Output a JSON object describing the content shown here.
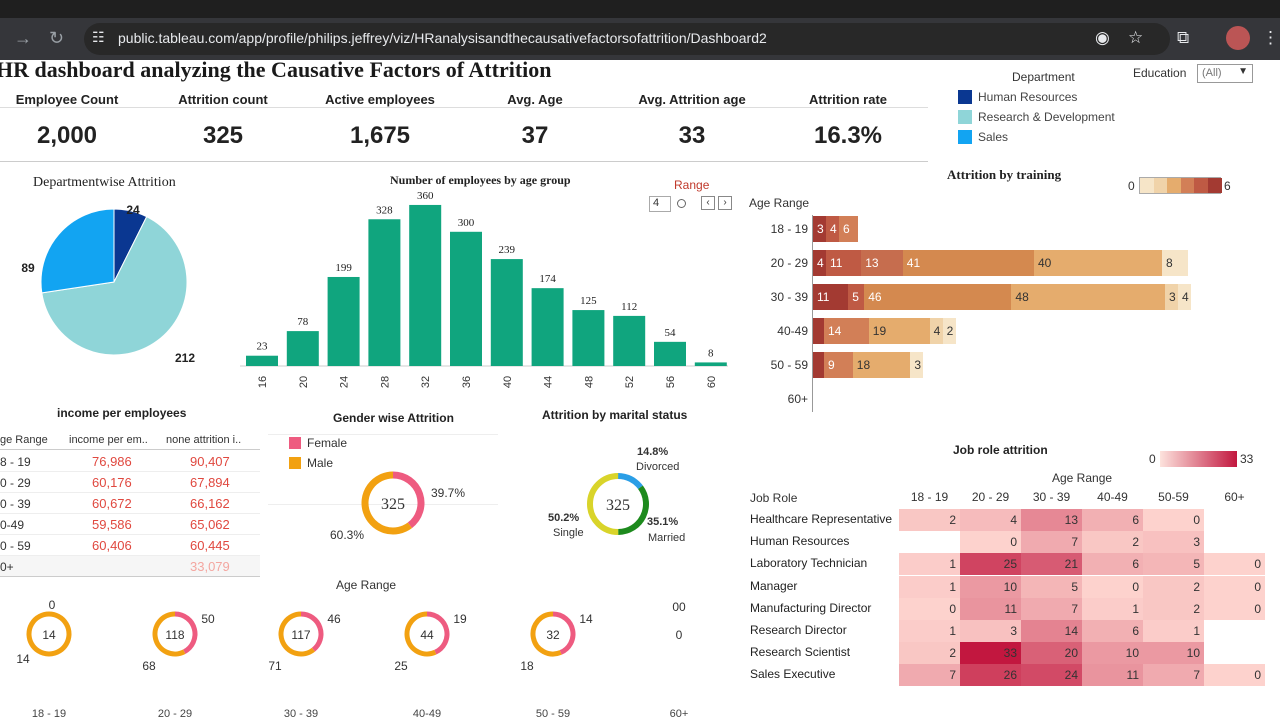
{
  "browser": {
    "url": "public.tableau.com/app/profile/philips.jeffrey/viz/HRanalysisandthecausativefactorsofattrition/Dashboard2"
  },
  "dashboard": {
    "title": "HR dashboard analyzing the Causative Factors of Attrition",
    "kpis": [
      {
        "label": "Employee Count",
        "value": "2,000"
      },
      {
        "label": "Attrition count",
        "value": "325"
      },
      {
        "label": "Active employees",
        "value": "1,675"
      },
      {
        "label": "Avg. Age",
        "value": "37"
      },
      {
        "label": "Avg. Attrition age",
        "value": "33"
      },
      {
        "label": "Attrition rate",
        "value": "16.3%"
      }
    ],
    "department_legend": {
      "title": "Department",
      "items": [
        {
          "label": "Human Resources",
          "color": "#0a3791"
        },
        {
          "label": "Research & Development",
          "color": "#8fd5d8"
        },
        {
          "label": "Sales",
          "color": "#12a4f2"
        }
      ]
    },
    "education_filter": {
      "label": "Education",
      "value": "(All)"
    },
    "range_control": {
      "label": "Range",
      "value": "4"
    }
  },
  "chart_data": [
    {
      "type": "pie",
      "title": "Departmentwise Attrition",
      "categories": [
        "Human Resources",
        "Research & Development",
        "Sales"
      ],
      "values": [
        24,
        212,
        89
      ],
      "colors": [
        "#0a3791",
        "#8fd5d8",
        "#12a4f2"
      ]
    },
    {
      "type": "bar",
      "title": "Number of employees by age group",
      "categories": [
        "16",
        "20",
        "24",
        "28",
        "32",
        "36",
        "40",
        "44",
        "48",
        "52",
        "56",
        "60"
      ],
      "values": [
        23,
        78,
        199,
        328,
        360,
        300,
        239,
        174,
        125,
        112,
        54,
        8
      ],
      "color": "#10a57e"
    },
    {
      "type": "bar",
      "title": "Attrition by training",
      "ylabel": "Age Range",
      "legend_min": "0",
      "legend_max": "6",
      "stacked": true,
      "categories": [
        "18 - 19",
        "20 - 29",
        "30 - 39",
        "40-49",
        "50 - 59",
        "60+"
      ],
      "rows": [
        [
          3,
          4,
          6
        ],
        [
          4,
          11,
          13,
          41,
          40,
          8
        ],
        [
          11,
          5,
          46,
          48,
          3,
          4
        ],
        [
          null,
          14,
          19,
          4,
          2
        ],
        [
          null,
          9,
          18,
          3
        ],
        []
      ],
      "row_labels": [
        [
          "3",
          "4",
          "6"
        ],
        [
          "4",
          "11",
          "13",
          "41",
          "40",
          "8"
        ],
        [
          "11",
          "5",
          "46",
          "48",
          "3",
          "4"
        ],
        [
          "",
          "14",
          "19",
          "4",
          "2"
        ],
        [
          "",
          "9",
          "18",
          "3"
        ],
        []
      ],
      "segment_colors": [
        "#a33a32",
        "#bf5a44",
        "#d27f57",
        "#e5ac6d",
        "#f0d3a9",
        "#f6e5c8"
      ]
    },
    {
      "type": "table",
      "title": "income per employees",
      "columns": [
        "ge Range",
        "income per em..",
        "none attrition i.."
      ],
      "rows": [
        [
          "8 - 19",
          "76,986",
          "90,407"
        ],
        [
          "0 - 29",
          "60,176",
          "67,894"
        ],
        [
          "0 - 39",
          "60,672",
          "66,162"
        ],
        [
          "0-49",
          "59,586",
          "65,062"
        ],
        [
          "0 - 59",
          "60,406",
          "60,445"
        ],
        [
          "0+",
          "",
          "33,079"
        ]
      ]
    },
    {
      "type": "pie",
      "title": "Gender wise Attrition",
      "categories": [
        "Female",
        "Male"
      ],
      "values": [
        39.7,
        60.3
      ],
      "labels": [
        "39.7%",
        "60.3%"
      ],
      "center": "325",
      "colors": [
        "#ee5b80",
        "#f2a111"
      ]
    },
    {
      "type": "pie",
      "title": "Attrition by marital status",
      "categories": [
        "Divorced",
        "Married",
        "Single"
      ],
      "values": [
        14.8,
        35.1,
        50.2
      ],
      "labels": [
        "14.8%",
        "35.1%",
        "50.2%"
      ],
      "center": "325",
      "colors": [
        "#2a9ee6",
        "#1d8a1d",
        "#d9d42a"
      ]
    },
    {
      "type": "pie",
      "title": "Age Range",
      "groups": [
        {
          "category": "18 - 19",
          "center": "14",
          "female": 0,
          "male": 14
        },
        {
          "category": "20 - 29",
          "center": "118",
          "female": 50,
          "male": 68
        },
        {
          "category": "30 - 39",
          "center": "117",
          "female": 46,
          "male": 71
        },
        {
          "category": "40-49",
          "center": "44",
          "female": 19,
          "male": 25
        },
        {
          "category": "50 - 59",
          "center": "32",
          "female": 14,
          "male": 18
        },
        {
          "category": "60+",
          "center": "",
          "female": "00",
          "male": "0"
        }
      ]
    },
    {
      "type": "heatmap",
      "title": "Job role attrition",
      "xlabel": "Age Range",
      "ylabel": "Job Role",
      "legend_min": "0",
      "legend_max": "33",
      "columns": [
        "18 - 19",
        "20 - 29",
        "30 - 39",
        "40-49",
        "50-59",
        "60+"
      ],
      "rows": [
        {
          "role": "Healthcare Representative",
          "values": [
            2,
            4,
            13,
            6,
            0,
            null
          ]
        },
        {
          "role": "Human Resources",
          "values": [
            null,
            0,
            7,
            2,
            3,
            null
          ]
        },
        {
          "role": "Laboratory Technician",
          "values": [
            1,
            25,
            21,
            6,
            5,
            0
          ]
        },
        {
          "role": "Manager",
          "values": [
            1,
            10,
            5,
            0,
            2,
            0
          ]
        },
        {
          "role": "Manufacturing Director",
          "values": [
            0,
            11,
            7,
            1,
            2,
            0
          ]
        },
        {
          "role": "Research Director",
          "values": [
            1,
            3,
            14,
            6,
            1,
            null
          ]
        },
        {
          "role": "Research Scientist",
          "values": [
            2,
            33,
            20,
            10,
            10,
            null
          ]
        },
        {
          "role": "Sales Executive",
          "values": [
            7,
            26,
            24,
            11,
            7,
            0
          ]
        }
      ]
    }
  ]
}
